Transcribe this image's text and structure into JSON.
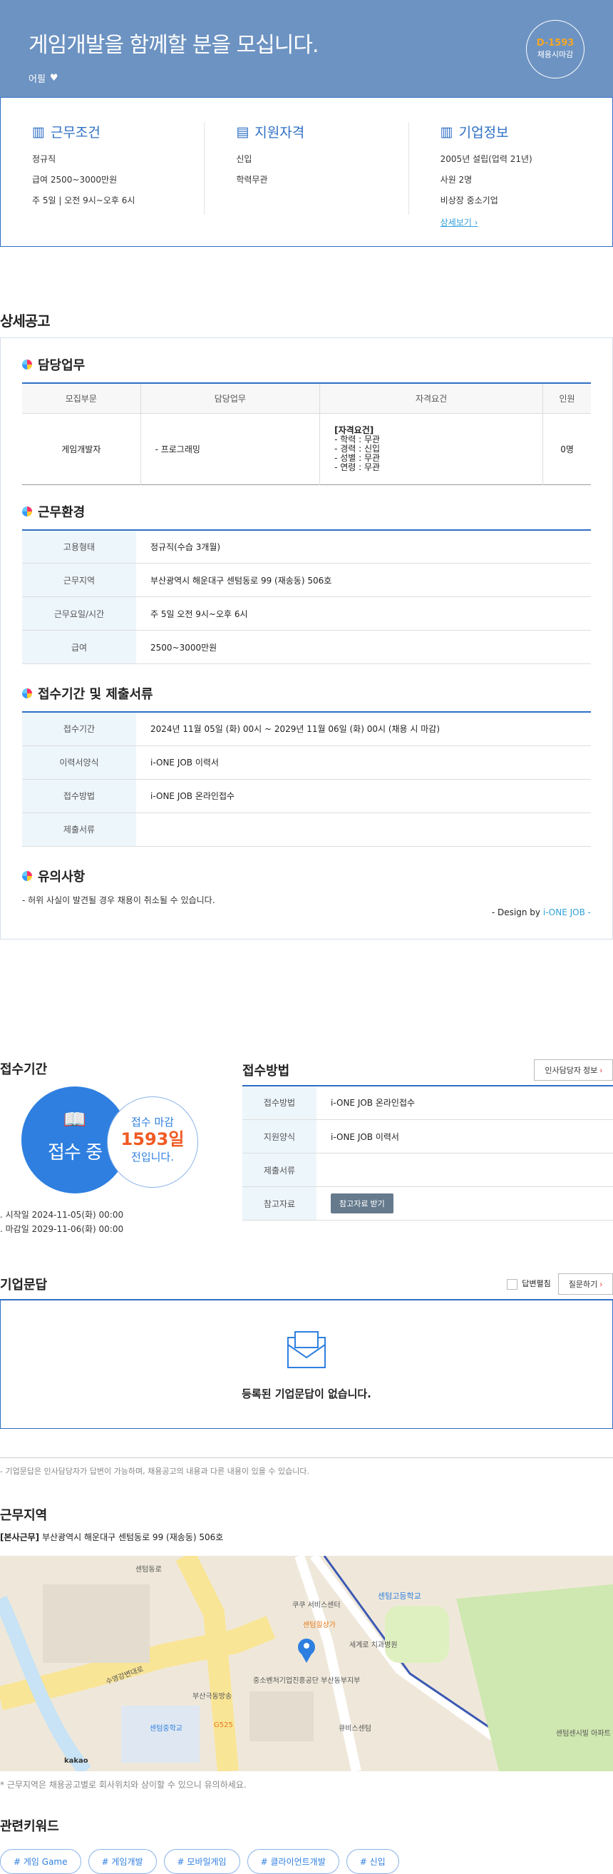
{
  "hero": {
    "title": "게임개발을 함께할 분을 모십니다.",
    "pick": "어필",
    "dday": "D-1593",
    "dday_sub": "채용시마감"
  },
  "summary": {
    "work": {
      "title": "근무조건",
      "items": [
        "정규직",
        "급여 2500~3000만원",
        "주 5일 | 오전 9시~오후 6시"
      ]
    },
    "qual": {
      "title": "지원자격",
      "items": [
        "신입",
        "학력무관"
      ]
    },
    "company": {
      "title": "기업정보",
      "items": [
        "2005년 설립(업력 21년)",
        "사원 2명",
        "비상장 중소기업"
      ],
      "more": "상세보기"
    }
  },
  "detail": {
    "title": "상세공고",
    "duty": {
      "title": "담당업무",
      "headers": [
        "모집부문",
        "담당업무",
        "자격요건",
        "인원"
      ],
      "row": {
        "part": "게임개발자",
        "task": "- 프로그래밍",
        "req_title": "[자격요건]",
        "req": [
          "- 학력 : 무관",
          "- 경력 : 신입",
          "- 성별 : 무관",
          "- 연령 : 무관"
        ],
        "count": "0명"
      }
    },
    "env": {
      "title": "근무환경",
      "rows": [
        [
          "고용형태",
          "정규직(수습 3개월)"
        ],
        [
          "근무지역",
          "부산광역시 해운대구 센텀동로 99 (재송동) 506호"
        ],
        [
          "근무요일/시간",
          "주 5일 오전 9시~오후 6시"
        ],
        [
          "급여",
          "2500~3000만원"
        ]
      ]
    },
    "apply": {
      "title": "접수기간 및 제출서류",
      "rows": [
        [
          "접수기간",
          "2024년 11월 05일 (화) 00시 ~ 2029년 11월 06일 (화) 00시 (채용 시 마감)"
        ],
        [
          "이력서양식",
          "i-ONE JOB 이력서"
        ],
        [
          "접수방법",
          "i-ONE JOB 온라인접수"
        ],
        [
          "제출서류",
          ""
        ]
      ]
    },
    "caution": {
      "title": "유의사항",
      "text": "- 허위 사실이 발견될 경우 채용이 취소될 수 있습니다.",
      "design": "- Design by",
      "brand": "i-ONE JOB -"
    }
  },
  "period": {
    "title": "접수기간",
    "status": "접수 중",
    "deadline_label": "접수 마감",
    "days": "1593일",
    "days_sub": "전입니다.",
    "start": "시작일 2024-11-05(화) 00:00",
    "end": "마감일 2029-11-06(화) 00:00"
  },
  "method": {
    "title": "접수방법",
    "hr_btn": "인사담당자 정보",
    "rows": [
      [
        "접수방법",
        "i-ONE JOB 온라인접수"
      ],
      [
        "지원양식",
        "i-ONE JOB 이력서"
      ],
      [
        "제출서류",
        ""
      ],
      [
        "참고자료",
        ""
      ]
    ],
    "download": "참고자료 받기"
  },
  "qa": {
    "title": "기업문답",
    "answered": "답변펼침",
    "ask": "질문하기",
    "empty": "등록된 기업문답이 없습니다.",
    "note": "- 기업문답은 인사담당자가 답변이 가능하며, 채용공고의 내용과 다른 내용이 있을 수 있습니다."
  },
  "location": {
    "title": "근무지역",
    "label": "[본사근무]",
    "addr": "부산광역시 해운대구 센텀동로 99 (재송동) 506호",
    "note": "* 근무지역은 채용공고별로 회사위치와 상이할 수 있으니 유의하세요.",
    "map_labels": [
      "센텀동로",
      "센텀고등학교",
      "쿠쿠 서비스센터",
      "센텀힐상가",
      "부산극동방송",
      "중소벤처기업진흥공단 부산동부지부",
      "센텀중학교",
      "G525",
      "세계로 치과병원",
      "큐비스센텀",
      "센텀센시빌 아파트",
      "수영강변대로",
      "kakao"
    ]
  },
  "keywords": {
    "title": "관련키워드",
    "items": [
      "# 게임 Game",
      "# 게임개발",
      "# 모바일게임",
      "# 클라이언트개발",
      "# 신입"
    ]
  }
}
